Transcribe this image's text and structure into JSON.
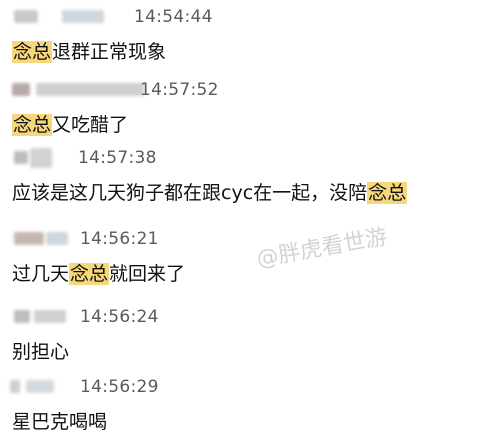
{
  "highlight_color": "#f6d77c",
  "messages": [
    {
      "time": "14:54:44",
      "before": "",
      "highlight": "念总",
      "after": "退群正常现象"
    },
    {
      "time": "14:57:52",
      "before": "",
      "highlight": "念总",
      "after": "又吃醋了"
    },
    {
      "time": "14:57:38",
      "before": "应该是这几天狗子都在跟cyc在一起，没陪",
      "highlight": "念总",
      "after": ""
    },
    {
      "time": "14:56:21",
      "before": "过几天",
      "highlight": "念总",
      "after": "就回来了"
    },
    {
      "time": "14:56:24",
      "before": "别担心",
      "highlight": "",
      "after": ""
    },
    {
      "time": "14:56:29",
      "before": "星巴克喝喝",
      "highlight": "",
      "after": ""
    }
  ],
  "watermark": "@胖虎看世游",
  "icons": {
    "sender_avatar": "blurred-avatar-icon",
    "sender_name": "blurred-name"
  }
}
